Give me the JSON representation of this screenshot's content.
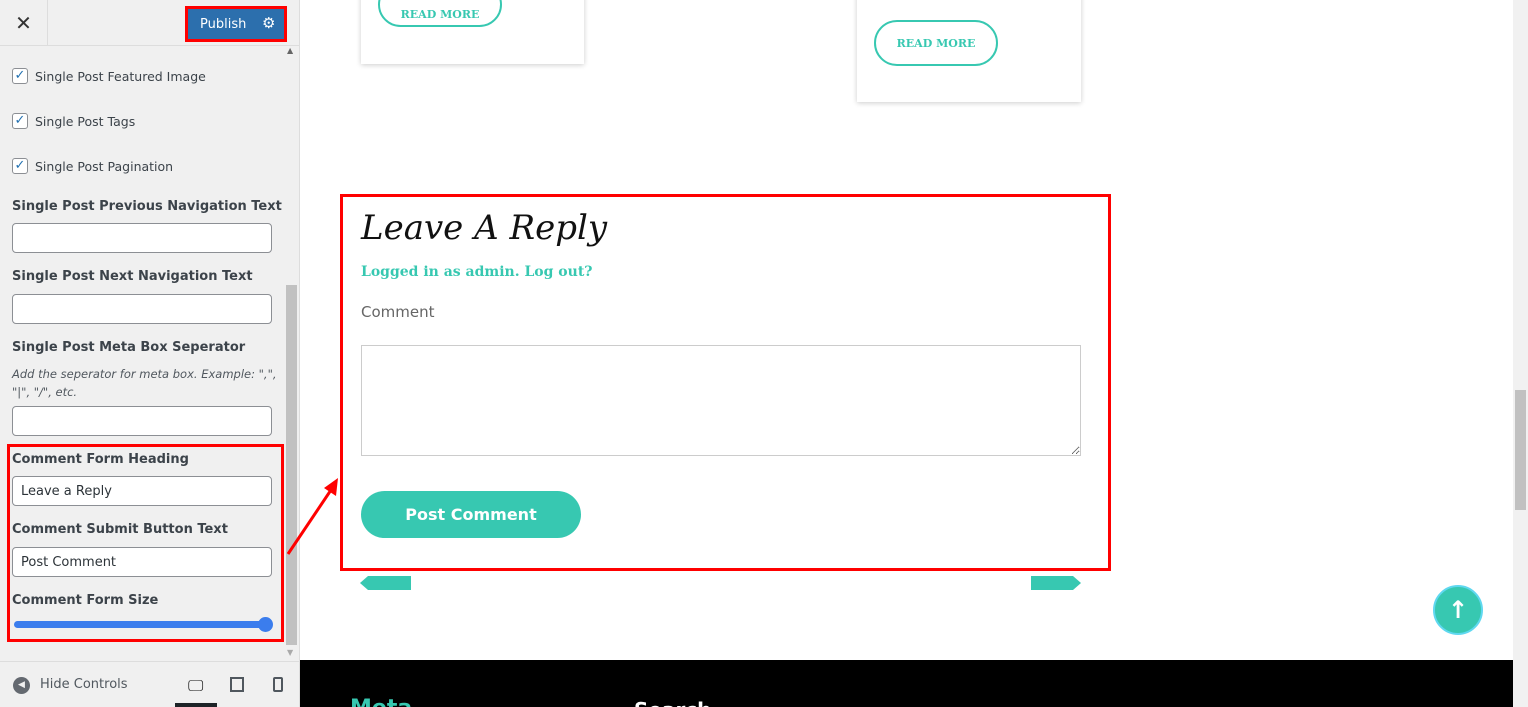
{
  "customizer": {
    "close_icon": "close-icon",
    "publish_label": "Publish",
    "settings_icon": "gear-icon",
    "checkboxes": [
      {
        "label": "Single Post Featured Image",
        "checked": true
      },
      {
        "label": "Single Post Tags",
        "checked": true
      },
      {
        "label": "Single Post Pagination",
        "checked": true
      }
    ],
    "fields": {
      "prev_nav": {
        "label": "Single Post Previous Navigation Text",
        "value": ""
      },
      "next_nav": {
        "label": "Single Post Next Navigation Text",
        "value": ""
      },
      "meta_sep": {
        "label": "Single Post Meta Box Seperator",
        "description": "Add the seperator for meta box. Example: \",\", \"|\", \"/\", etc.",
        "value": ""
      },
      "comment_heading": {
        "label": "Comment Form Heading",
        "value": "Leave a Reply"
      },
      "comment_button": {
        "label": "Comment Submit Button Text",
        "value": "Post Comment"
      },
      "comment_size": {
        "label": "Comment Form Size",
        "value_percent": 100
      }
    },
    "hide_controls": "Hide Controls",
    "slider_color": "#3b7ded"
  },
  "preview": {
    "read_more": "READ MORE",
    "reply_heading": "Leave A Reply",
    "logged_in": "Logged in as admin.",
    "log_out": "Log out?",
    "comment_label": "Comment",
    "comment_value": "",
    "post_comment": "Post Comment",
    "footer": {
      "meta": "Meta",
      "search": "Search"
    },
    "accent_color": "#37c8b1",
    "highlight_color": "#ff0000"
  }
}
